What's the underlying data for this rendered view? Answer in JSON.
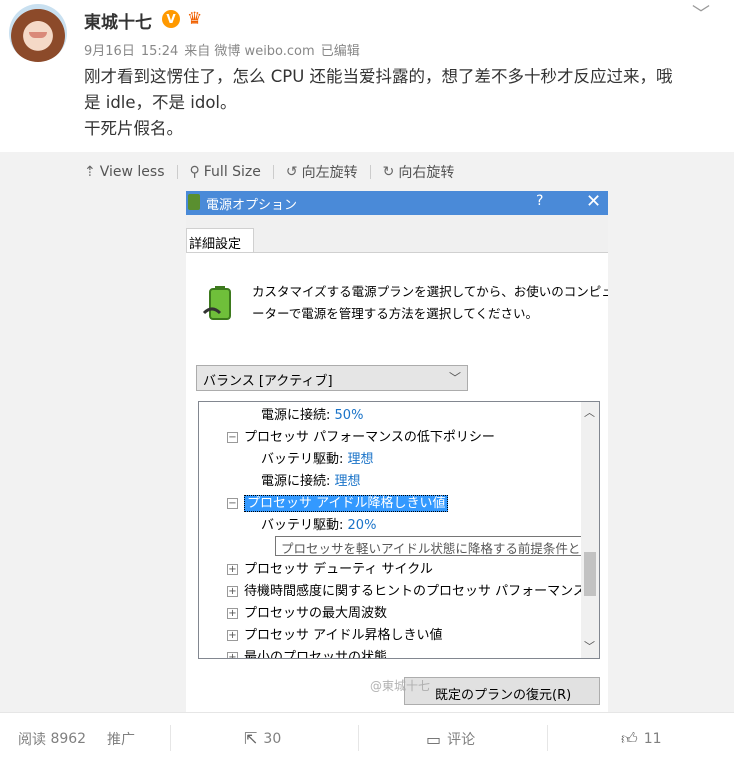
{
  "post": {
    "username": "東城十七",
    "vbadge": "V",
    "crown_icon": "crown-icon",
    "meta": {
      "date": "9月16日",
      "time": "15:24",
      "source": "来自 微博 weibo.com",
      "edited": "已编辑"
    },
    "content_lines": [
      "刚才看到这愣住了，怎么 CPU 还能当爱抖露的，想了差不多十秒才反应过来，哦",
      "是 idle，不是 idol。",
      "干死片假名。"
    ]
  },
  "media_bar": {
    "view_less": "View less",
    "full_size": "Full Size",
    "rotate_left": "向左旋转",
    "rotate_right": "向右旋转"
  },
  "dialog": {
    "title": "電源オプション",
    "help": "?",
    "close": "✕",
    "tab": "詳細設定",
    "description_lines": [
      "カスタマイズする電源プランを選択してから、お使いのコンピュ",
      "ーターで電源を管理する方法を選択してください。"
    ],
    "plan": "バランス [アクティブ]",
    "tree": [
      {
        "indent": 2,
        "label": "電源に接続:",
        "value": "50%"
      },
      {
        "indent": 1,
        "expander": "⊟",
        "label": "プロセッサ パフォーマンスの低下ポリシー"
      },
      {
        "indent": 2,
        "label": "バッテリ駆動:",
        "value": "理想"
      },
      {
        "indent": 2,
        "label": "電源に接続:",
        "value": "理想"
      },
      {
        "indent": 1,
        "expander": "⊟",
        "label": "プロセッサ アイドル降格しきい値",
        "selected": true
      },
      {
        "indent": 2,
        "label": "バッテリ駆動:",
        "value": "20%"
      },
      {
        "indent": 2,
        "label": ""
      },
      {
        "indent": 1,
        "expander": "⊞",
        "label": "プロセッサ デューティ サイクル"
      },
      {
        "indent": 1,
        "expander": "⊞",
        "label": "待機時間感度に関するヒントのプロセッサ パフォーマンス"
      },
      {
        "indent": 1,
        "expander": "⊞",
        "label": "プロセッサの最大周波数"
      },
      {
        "indent": 1,
        "expander": "⊞",
        "label": "プロセッサ アイドル昇格しきい値"
      },
      {
        "indent": 1,
        "expander": "⊞",
        "label": "最小のプロセッサの状態"
      }
    ],
    "tooltip": "プロセッサを軽いアイドル状態に降格する前提条件とする上",
    "restore_button": "既定のプランの復元(R)",
    "watermark": "@東城十七"
  },
  "footer": {
    "reads_label": "阅读",
    "reads_count": "8962",
    "promote": "推广",
    "repost_count": "30",
    "comment": "评论",
    "like_count": "11"
  }
}
